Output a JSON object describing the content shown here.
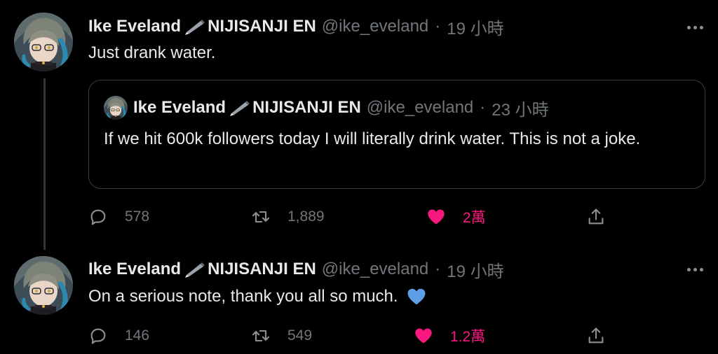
{
  "tweets": [
    {
      "name": "Ike Eveland",
      "suffix": "NIJISANJI EN",
      "handle": "@ike_eveland",
      "separator": "·",
      "time": "19 小時",
      "text": "Just drank water.",
      "quote": {
        "name": "Ike Eveland",
        "suffix": "NIJISANJI EN",
        "handle": "@ike_eveland",
        "separator": "·",
        "time": "23 小時",
        "text": "If we hit 600k followers today I will literally drink water. This is not a joke."
      },
      "replies": "578",
      "retweets": "1,889",
      "likes": "2萬",
      "liked": true
    },
    {
      "name": "Ike Eveland",
      "suffix": "NIJISANJI EN",
      "handle": "@ike_eveland",
      "separator": "·",
      "time": "19 小時",
      "text": "On a serious note, thank you all so much.",
      "emoji": "blue-heart-icon",
      "replies": "146",
      "retweets": "549",
      "likes": "1.2萬",
      "liked": true
    }
  ],
  "colors": {
    "background": "#000000",
    "text": "#e7e9ea",
    "muted": "#71767b",
    "like": "#f91880",
    "blue_heart": "#5d9ee6"
  }
}
